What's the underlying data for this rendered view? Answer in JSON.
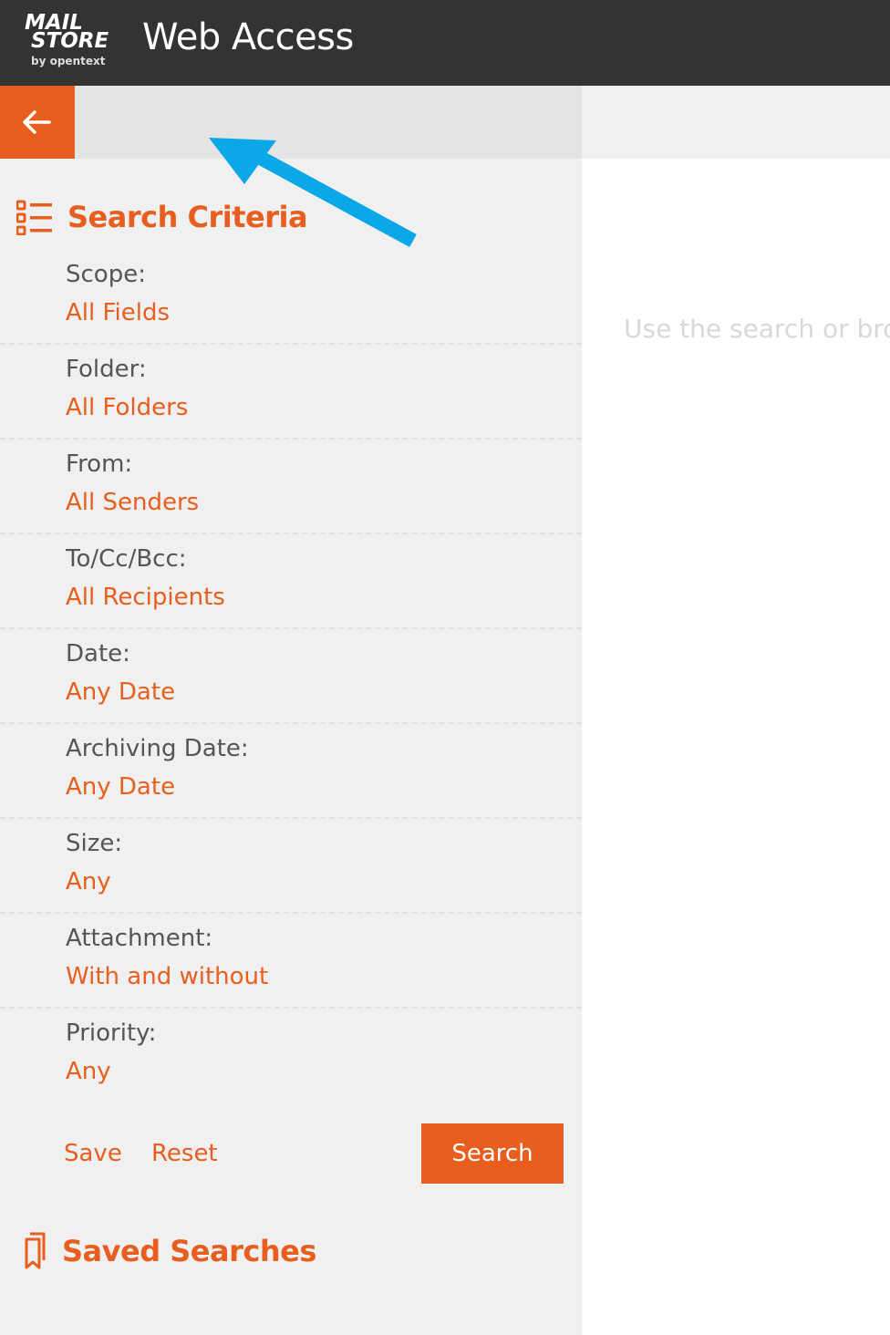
{
  "header": {
    "logo": {
      "line1": "MAIL",
      "line2": "STORE",
      "line3": "by opentext"
    },
    "title": "Web Access"
  },
  "toolbar": {
    "back_icon": "arrow-left-icon"
  },
  "search_criteria": {
    "icon": "list-icon",
    "title": "Search Criteria",
    "items": [
      {
        "label": "Scope:",
        "value": "All Fields"
      },
      {
        "label": "Folder:",
        "value": "All Folders"
      },
      {
        "label": "From:",
        "value": "All Senders"
      },
      {
        "label": "To/Cc/Bcc:",
        "value": "All Recipients"
      },
      {
        "label": "Date:",
        "value": "Any Date"
      },
      {
        "label": "Archiving Date:",
        "value": "Any Date"
      },
      {
        "label": "Size:",
        "value": "Any"
      },
      {
        "label": "Attachment:",
        "value": "With and without"
      },
      {
        "label": "Priority:",
        "value": "Any"
      }
    ],
    "actions": {
      "save_label": "Save",
      "reset_label": "Reset",
      "search_label": "Search"
    }
  },
  "saved_searches": {
    "icon": "bookmark-icon",
    "title": "Saved Searches"
  },
  "main": {
    "placeholder_text": "Use the search or brow"
  },
  "colors": {
    "accent": "#e85e1e",
    "header_bg": "#333333",
    "sidebar_bg": "#f0f0f0",
    "toolbar_bg": "#e4e4e4",
    "annotation_arrow": "#0aa8e6"
  }
}
